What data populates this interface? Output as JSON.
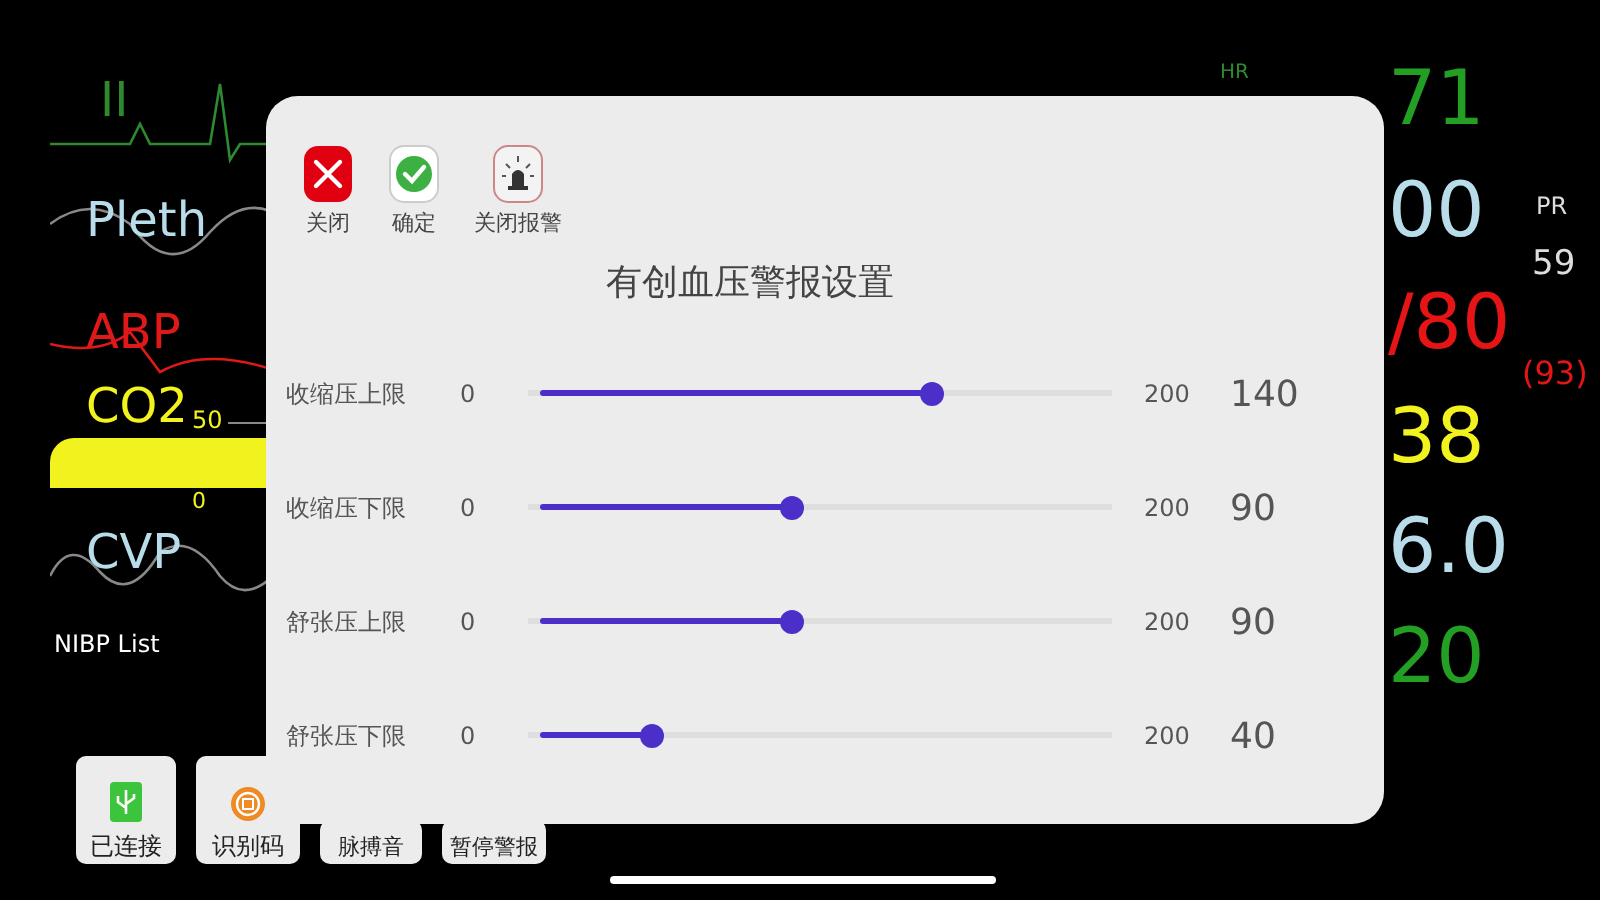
{
  "monitor": {
    "waveforms": [
      {
        "label": "II",
        "color": "#2f8a2f"
      },
      {
        "label": "Pleth",
        "color": "#b8dcea"
      },
      {
        "label": "ABP",
        "color": "#e01818"
      },
      {
        "label": "CO2",
        "color": "#f2f21e"
      },
      {
        "label": "CVP",
        "color": "#b8dcea"
      }
    ],
    "co2_scale": [
      "50",
      "0"
    ],
    "nibp_list": "NIBP List",
    "hr_label": "HR",
    "vitals": [
      {
        "value": "71",
        "color": "#23a023"
      },
      {
        "value": "00",
        "color": "#b8dcea"
      },
      {
        "value": "/80",
        "color": "#e51515"
      },
      {
        "value": "38",
        "color": "#f2f21e"
      },
      {
        "value": "6.0",
        "color": "#b8dcea"
      },
      {
        "value": "20",
        "color": "#23a023"
      }
    ],
    "pr": {
      "label": "PR",
      "value": "59"
    },
    "mean": "(93)"
  },
  "dialog": {
    "toolbar": [
      {
        "label": "关闭",
        "kind": "close"
      },
      {
        "label": "确定",
        "kind": "confirm"
      },
      {
        "label": "关闭报警",
        "kind": "alarm_off"
      }
    ],
    "title": "有创血压警报设置",
    "sliders": [
      {
        "label": "收缩压上限",
        "min": "0",
        "max": "200",
        "level": 0.7,
        "value": "140"
      },
      {
        "label": "收缩压下限",
        "min": "0",
        "max": "200",
        "level": 0.45,
        "value": "90"
      },
      {
        "label": "舒张压上限",
        "min": "0",
        "max": "200",
        "level": 0.45,
        "value": "90"
      },
      {
        "label": "舒张压下限",
        "min": "0",
        "max": "200",
        "level": 0.2,
        "value": "40"
      }
    ]
  },
  "bottom_buttons": [
    {
      "label": "已连接",
      "kind": "usb"
    },
    {
      "label": "识别码",
      "kind": "id"
    },
    {
      "label": "脉搏音",
      "kind": "plain"
    },
    {
      "label": "暂停警报",
      "kind": "plain"
    }
  ]
}
